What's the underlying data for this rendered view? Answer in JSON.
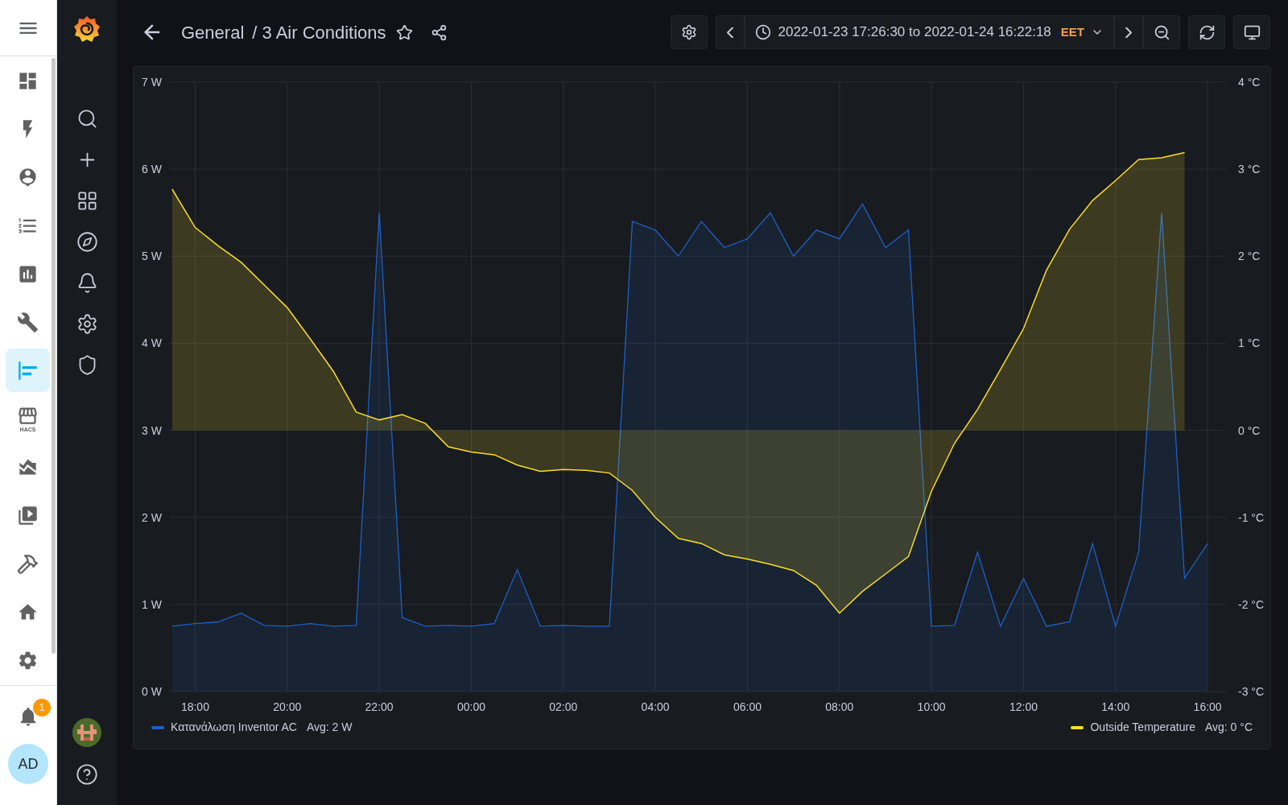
{
  "ha_sidebar": {
    "items": [
      {
        "kind": "dashboard",
        "selected": false
      },
      {
        "kind": "energy",
        "selected": false
      },
      {
        "kind": "person-card",
        "selected": false
      },
      {
        "kind": "list",
        "selected": false
      },
      {
        "kind": "bar-chart",
        "selected": false
      },
      {
        "kind": "wrench",
        "selected": false
      },
      {
        "kind": "grafana",
        "selected": true
      },
      {
        "kind": "store",
        "selected": false,
        "label": "HACS"
      },
      {
        "kind": "area-chart",
        "selected": false
      },
      {
        "kind": "media",
        "selected": false
      },
      {
        "kind": "hammer",
        "selected": false
      },
      {
        "kind": "home",
        "selected": false
      },
      {
        "kind": "settings",
        "selected": false
      }
    ],
    "notifications": {
      "badge": "1"
    },
    "user": {
      "initials": "AD"
    }
  },
  "grafana_sidebar": {
    "items": [
      {
        "kind": "search"
      },
      {
        "kind": "plus"
      },
      {
        "kind": "grid"
      },
      {
        "kind": "compass"
      },
      {
        "kind": "bell"
      },
      {
        "kind": "gear"
      },
      {
        "kind": "shield"
      }
    ]
  },
  "header": {
    "folder": "General",
    "title": "/ 3 Air Conditions",
    "time_range": "2022-01-23 17:26:30 to 2022-01-24 16:22:18",
    "timezone": "EET"
  },
  "panel": {
    "chart_data": {
      "type": "area",
      "grid": true,
      "ylim": [
        0,
        7
      ],
      "y2lim": [
        -3,
        4
      ],
      "categories": [
        null,
        "18:00",
        null,
        null,
        null,
        "20:00",
        null,
        null,
        null,
        "22:00",
        null,
        null,
        null,
        "00:00",
        null,
        null,
        null,
        "02:00",
        null,
        null,
        null,
        "04:00",
        null,
        null,
        null,
        "06:00",
        null,
        null,
        null,
        "08:00",
        null,
        null,
        null,
        "10:00",
        null,
        null,
        null,
        "12:00",
        null,
        null,
        null,
        "14:00",
        null,
        null,
        null,
        "16:00"
      ],
      "yticks": [
        {
          "value": 0,
          "label": "0 W"
        },
        {
          "value": 1,
          "label": "1 W"
        },
        {
          "value": 2,
          "label": "2 W"
        },
        {
          "value": 3,
          "label": "3 W"
        },
        {
          "value": 4,
          "label": "4 W"
        },
        {
          "value": 5,
          "label": "5 W"
        },
        {
          "value": 6,
          "label": "6 W"
        },
        {
          "value": 7,
          "label": "7 W"
        }
      ],
      "y2ticks": [
        {
          "value": -3,
          "label": "-3 °C"
        },
        {
          "value": -2,
          "label": "-2 °C"
        },
        {
          "value": -1,
          "label": "-1 °C"
        },
        {
          "value": 0,
          "label": "0 °C"
        },
        {
          "value": 1,
          "label": "1 °C"
        },
        {
          "value": 2,
          "label": "2 °C"
        },
        {
          "value": 3,
          "label": "3 °C"
        },
        {
          "value": 4,
          "label": "4 °C"
        }
      ],
      "series": [
        {
          "name": "Κατανάλωση Inventor AC",
          "color": "#1f60c4",
          "values": [
            0.75,
            0.78,
            0.8,
            0.9,
            0.76,
            0.75,
            0.78,
            0.75,
            0.76,
            5.5,
            0.85,
            0.75,
            0.76,
            0.75,
            0.78,
            1.4,
            0.75,
            0.76,
            0.75,
            0.75,
            5.4,
            5.3,
            5.0,
            5.4,
            5.1,
            5.2,
            5.5,
            5.0,
            5.3,
            5.2,
            5.6,
            5.1,
            5.3,
            0.75,
            0.76,
            1.6,
            0.75,
            1.3,
            0.75,
            0.8,
            1.7,
            0.75,
            1.6,
            5.5,
            1.3,
            1.7
          ]
        },
        {
          "name": "Outside Temperature",
          "color": "#fade2a",
          "axis": "y2",
          "values": [
            2.77,
            2.33,
            2.12,
            1.93,
            1.67,
            1.41,
            1.05,
            0.68,
            0.21,
            0.12,
            0.18,
            0.08,
            -0.19,
            -0.25,
            -0.28,
            -0.4,
            -0.47,
            -0.45,
            -0.46,
            -0.49,
            -0.69,
            -1.0,
            -1.24,
            -1.3,
            -1.43,
            -1.48,
            -1.54,
            -1.61,
            -1.78,
            -2.1,
            -1.85,
            -1.65,
            -1.45,
            -0.7,
            -0.15,
            0.24,
            0.7,
            1.17,
            1.84,
            2.31,
            2.64,
            2.87,
            3.11,
            3.13,
            3.19,
            null
          ]
        }
      ]
    },
    "legend_averages": [
      "Avg: 2 W",
      "Avg: 0 °C"
    ]
  }
}
